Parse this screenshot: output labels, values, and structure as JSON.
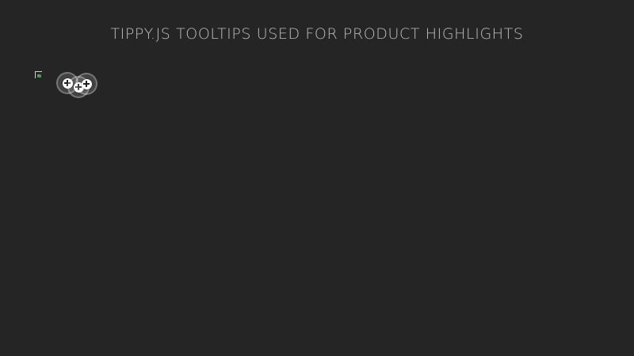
{
  "header": {
    "title": "TIPPY.JS TOOLTIPS USED FOR PRODUCT HIGHLIGHTS"
  },
  "product": {
    "image_state": "broken-image",
    "hotspots": [
      {
        "icon": "plus-icon"
      },
      {
        "icon": "plus-icon"
      },
      {
        "icon": "plus-icon"
      }
    ]
  },
  "colors": {
    "background": "#252525",
    "title": "#bdbdbd",
    "hotspot_fill": "#ffffff"
  }
}
